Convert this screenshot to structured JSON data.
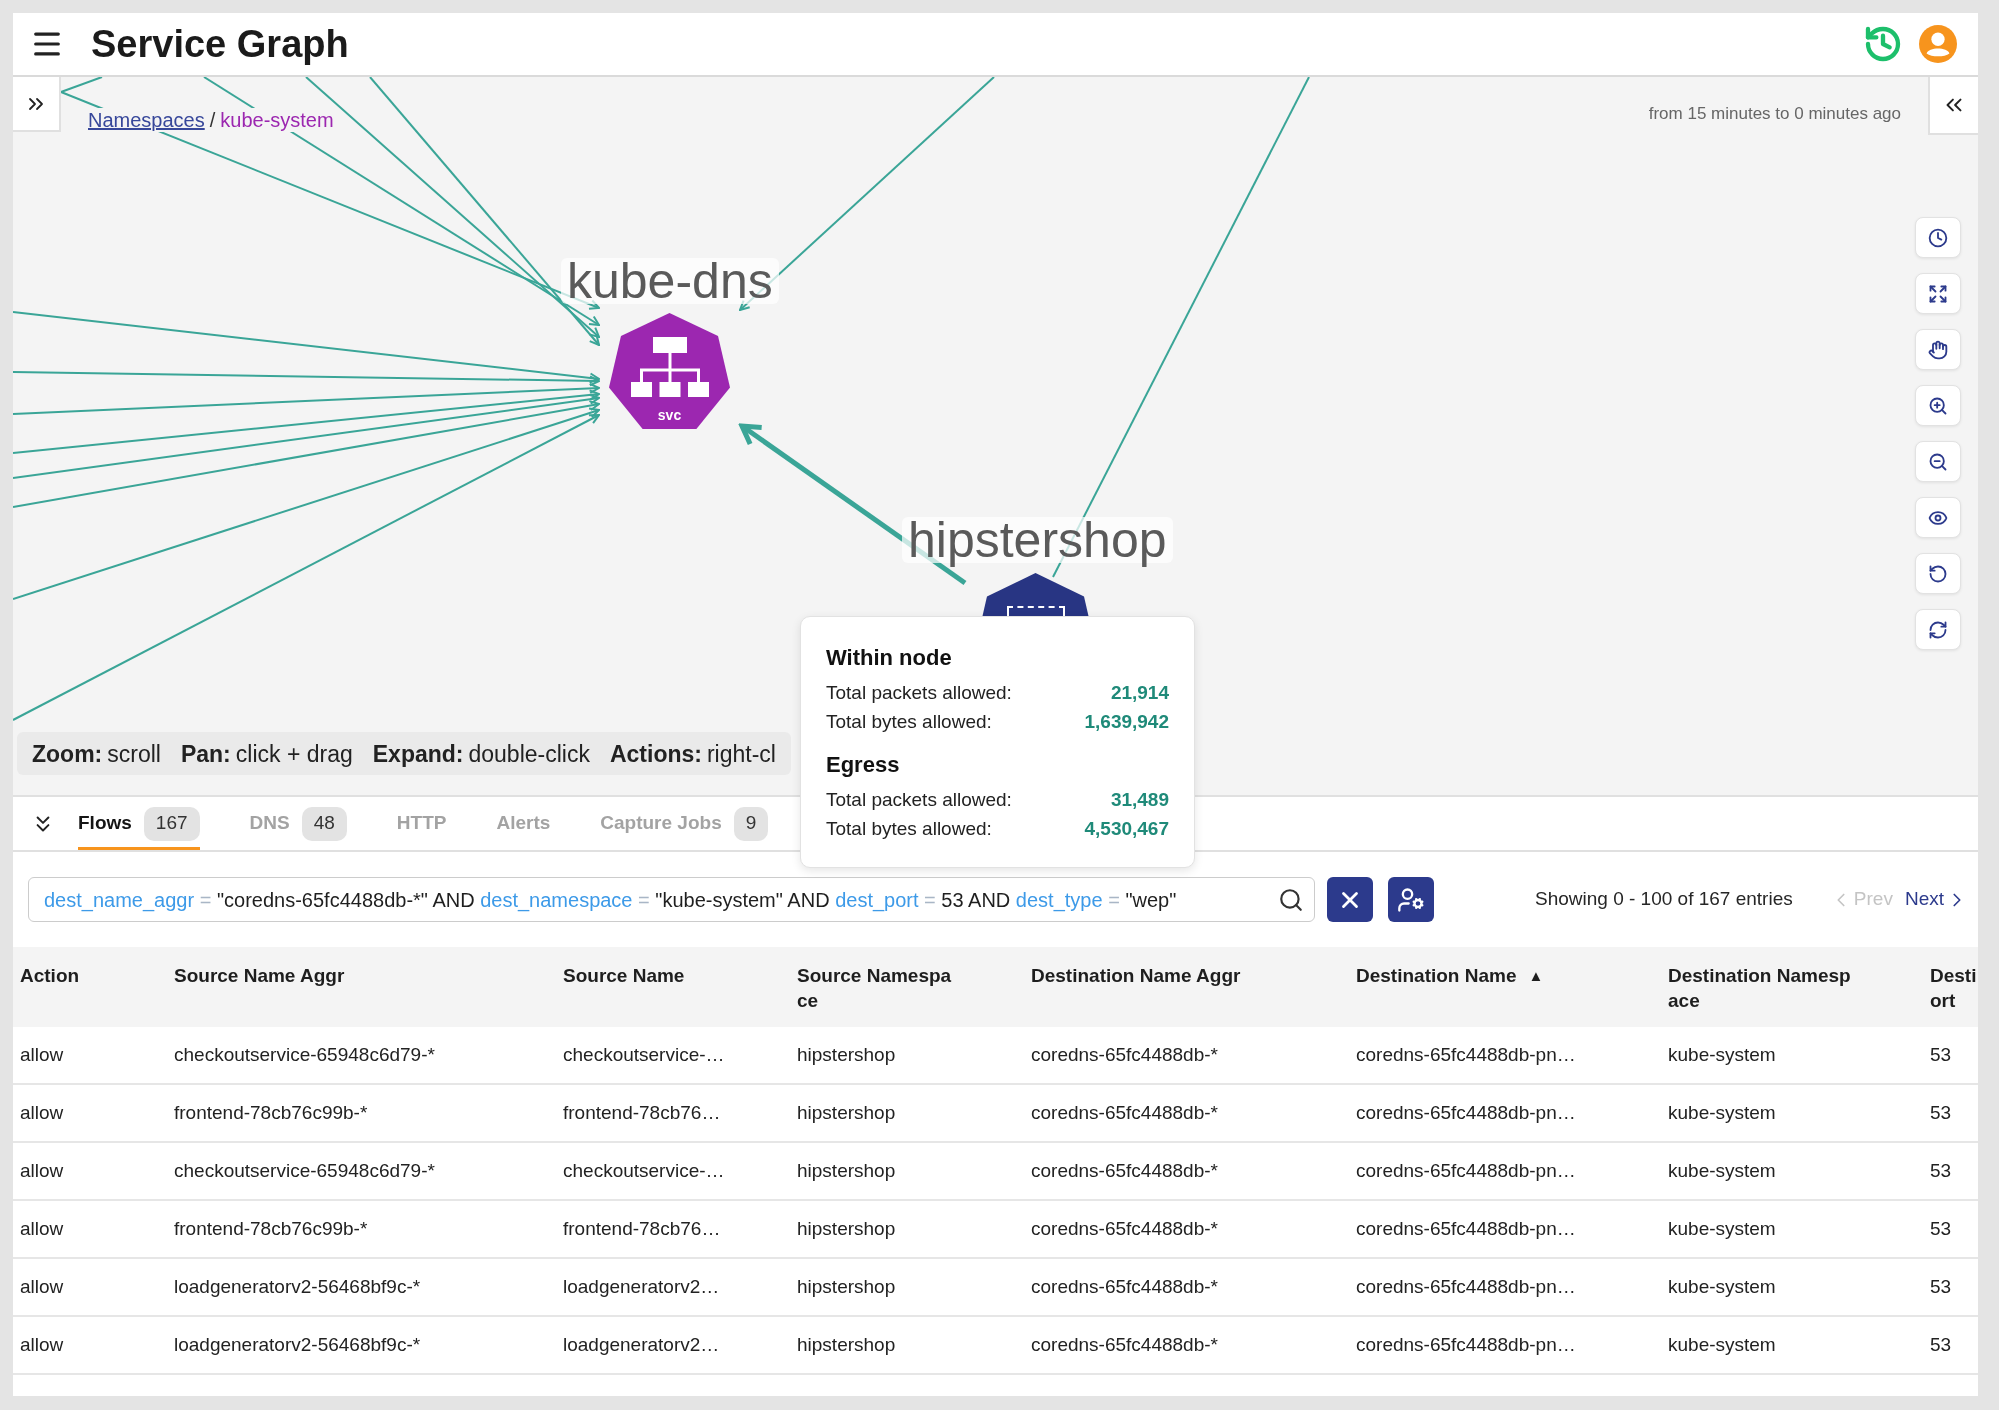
{
  "header": {
    "title": "Service Graph"
  },
  "graph": {
    "breadcrumb": {
      "items": [
        {
          "label": "Namespaces",
          "kind": "link"
        },
        {
          "label": "kube-system",
          "kind": "current"
        }
      ],
      "separator": "/"
    },
    "time_range": "from 15 minutes to 0 minutes ago",
    "nodes": [
      {
        "label": "kube-dns",
        "kind": "service",
        "type_label": "svc"
      },
      {
        "label": "hipstershop",
        "kind": "namespace"
      }
    ],
    "legend": [
      {
        "key": "Zoom:",
        "value": "scroll"
      },
      {
        "key": "Pan:",
        "value": "click + drag"
      },
      {
        "key": "Expand:",
        "value": "double-click"
      },
      {
        "key": "Actions:",
        "value": "right-cl"
      }
    ],
    "tooltip": {
      "sections": [
        {
          "title": "Within node",
          "rows": [
            {
              "label": "Total packets allowed:",
              "value": "21,914"
            },
            {
              "label": "Total bytes allowed:",
              "value": "1,639,942"
            }
          ]
        },
        {
          "title": "Egress",
          "rows": [
            {
              "label": "Total packets allowed:",
              "value": "31,489"
            },
            {
              "label": "Total bytes allowed:",
              "value": "4,530,467"
            }
          ]
        }
      ]
    }
  },
  "tabs": [
    {
      "label": "Flows",
      "count": "167",
      "selected": true
    },
    {
      "label": "DNS",
      "count": "48",
      "selected": false
    },
    {
      "label": "HTTP",
      "selected": false
    },
    {
      "label": "Alerts",
      "selected": false
    },
    {
      "label": "Capture Jobs",
      "count": "9",
      "selected": false
    }
  ],
  "filter": {
    "query": [
      {
        "kind": "field",
        "text": "dest_name_aggr"
      },
      {
        "kind": "operator",
        "text": "="
      },
      {
        "kind": "value",
        "text": "\"coredns-65fc4488db-*\""
      },
      {
        "kind": "keyword",
        "text": "AND"
      },
      {
        "kind": "field",
        "text": "dest_namespace"
      },
      {
        "kind": "operator",
        "text": "="
      },
      {
        "kind": "value",
        "text": "\"kube-system\""
      },
      {
        "kind": "keyword",
        "text": "AND"
      },
      {
        "kind": "field",
        "text": "dest_port"
      },
      {
        "kind": "operator",
        "text": "="
      },
      {
        "kind": "value",
        "text": "53"
      },
      {
        "kind": "keyword",
        "text": "AND"
      },
      {
        "kind": "field",
        "text": "dest_type"
      },
      {
        "kind": "operator",
        "text": "="
      },
      {
        "kind": "value",
        "text": "\"wep\""
      }
    ]
  },
  "pagination": {
    "summary": "Showing 0 - 100 of 167 entries",
    "prev": {
      "label": "Prev",
      "disabled": true
    },
    "next": {
      "label": "Next",
      "disabled": false
    }
  },
  "table": {
    "columns": [
      {
        "label": "Action"
      },
      {
        "label": "Source Name Aggr"
      },
      {
        "label": "Source Name"
      },
      {
        "label": "Source Namespace"
      },
      {
        "label": "Destination Name Aggr"
      },
      {
        "label": "Destination Name",
        "sort_indicator": "▲"
      },
      {
        "label": "Destination Namespace"
      },
      {
        "label": "Desti\nort"
      }
    ],
    "rows": [
      {
        "cells": [
          "allow",
          "checkoutservice-65948c6d79-*",
          "checkoutservice-…",
          "hipstershop",
          "coredns-65fc4488db-*",
          "coredns-65fc4488db-pn…",
          "kube-system",
          "53"
        ]
      },
      {
        "cells": [
          "allow",
          "frontend-78cb76c99b-*",
          "frontend-78cb76…",
          "hipstershop",
          "coredns-65fc4488db-*",
          "coredns-65fc4488db-pn…",
          "kube-system",
          "53"
        ]
      },
      {
        "cells": [
          "allow",
          "checkoutservice-65948c6d79-*",
          "checkoutservice-…",
          "hipstershop",
          "coredns-65fc4488db-*",
          "coredns-65fc4488db-pn…",
          "kube-system",
          "53"
        ]
      },
      {
        "cells": [
          "allow",
          "frontend-78cb76c99b-*",
          "frontend-78cb76…",
          "hipstershop",
          "coredns-65fc4488db-*",
          "coredns-65fc4488db-pn…",
          "kube-system",
          "53"
        ]
      },
      {
        "cells": [
          "allow",
          "loadgeneratorv2-56468bf9c-*",
          "loadgeneratorv2…",
          "hipstershop",
          "coredns-65fc4488db-*",
          "coredns-65fc4488db-pn…",
          "kube-system",
          "53"
        ]
      },
      {
        "cells": [
          "allow",
          "loadgeneratorv2-56468bf9c-*",
          "loadgeneratorv2…",
          "hipstershop",
          "coredns-65fc4488db-*",
          "coredns-65fc4488db-pn…",
          "kube-system",
          "53"
        ]
      }
    ]
  }
}
